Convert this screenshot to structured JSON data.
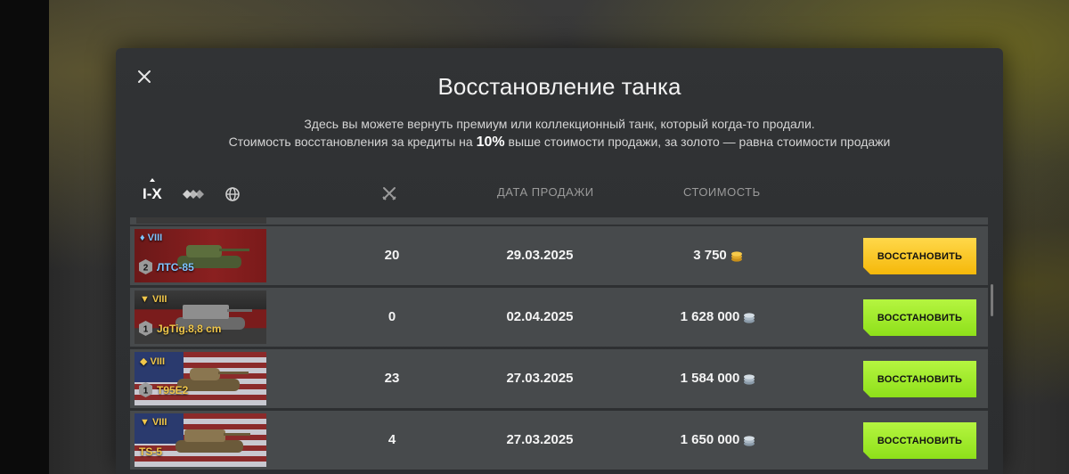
{
  "dialog": {
    "title": "Восстановление танка",
    "desc_line1": "Здесь вы можете вернуть премиум или коллекционный танк, который когда-то продали.",
    "desc_line2_before": "Стоимость восстановления за кредиты на ",
    "desc_line2_bold": "10%",
    "desc_line2_after": " выше стоимости продажи, за золото — равна стоимости продажи",
    "close_icon": "close-icon"
  },
  "filters": {
    "tier_label": "I-X",
    "type_icon": "vehicle-types-icon",
    "nation_icon": "globe-icon"
  },
  "columns": {
    "battles_icon": "crossed-swords-icon",
    "date_header": "ДАТА ПРОДАЖИ",
    "cost_header": "СТОИМОСТЬ"
  },
  "rows": [
    {
      "tier": "VIII",
      "tank_class_icon": "heavy-tank-icon",
      "mastery": "2",
      "name": "ЛТС-85",
      "battles": "20",
      "date": "29.03.2025",
      "cost": "3 750",
      "currency_icon": "gold-coins-icon",
      "button": "ВОССТАНОВИТЬ"
    },
    {
      "tier": "VIII",
      "tank_class_icon": "tank-destroyer-icon",
      "mastery": "1",
      "name": "JgTig.8,8 cm",
      "battles": "0",
      "date": "02.04.2025",
      "cost": "1 628 000",
      "currency_icon": "silver-credits-icon",
      "button": "ВОССТАНОВИТЬ"
    },
    {
      "tier": "VIII",
      "tank_class_icon": "medium-tank-icon",
      "mastery": "1",
      "name": "T95E2",
      "battles": "23",
      "date": "27.03.2025",
      "cost": "1 584 000",
      "currency_icon": "silver-credits-icon",
      "button": "ВОССТАНОВИТЬ"
    },
    {
      "tier": "VIII",
      "tank_class_icon": "tank-destroyer-icon",
      "mastery": "",
      "name": "TS-5",
      "battles": "4",
      "date": "27.03.2025",
      "cost": "1 650 000",
      "currency_icon": "silver-credits-icon",
      "button": "ВОССТАНОВИТЬ"
    }
  ],
  "colors": {
    "gold_button": "#f5b80a",
    "green_button": "#8ee01a",
    "premium_name": "#7fc4ff",
    "collector_name": "#f1c74a"
  }
}
